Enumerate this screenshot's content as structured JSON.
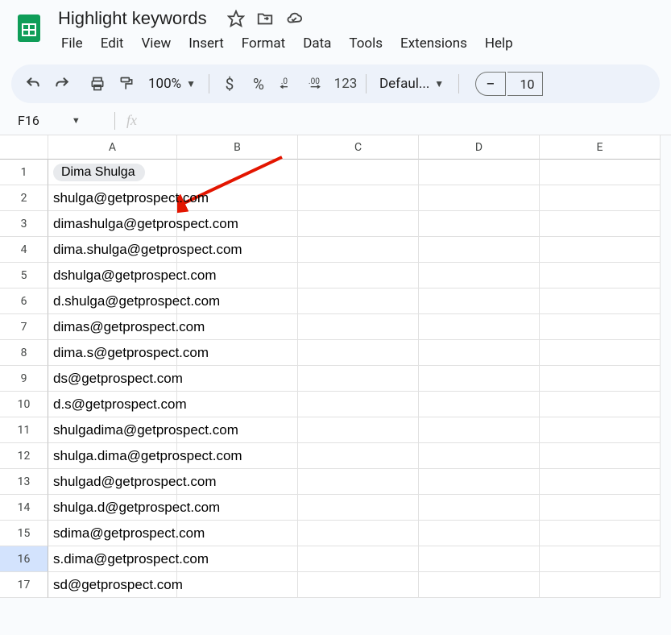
{
  "doc": {
    "title": "Highlight keywords"
  },
  "menubar": [
    "File",
    "Edit",
    "View",
    "Insert",
    "Format",
    "Data",
    "Tools",
    "Extensions",
    "Help"
  ],
  "toolbar": {
    "zoom": "100%",
    "font": "Defaul...",
    "fontsize": "10"
  },
  "namebox": "F16",
  "columns": [
    "A",
    "B",
    "C",
    "D",
    "E"
  ],
  "chart_data": {
    "type": "table",
    "columns": [
      "A"
    ],
    "rows": [
      {
        "n": 1,
        "a": "Dima Shulga",
        "chip": true
      },
      {
        "n": 2,
        "a": "shulga@getprospect.com"
      },
      {
        "n": 3,
        "a": "dimashulga@getprospect.com"
      },
      {
        "n": 4,
        "a": "dima.shulga@getprospect.com"
      },
      {
        "n": 5,
        "a": "dshulga@getprospect.com"
      },
      {
        "n": 6,
        "a": "d.shulga@getprospect.com"
      },
      {
        "n": 7,
        "a": "dimas@getprospect.com"
      },
      {
        "n": 8,
        "a": "dima.s@getprospect.com"
      },
      {
        "n": 9,
        "a": "ds@getprospect.com"
      },
      {
        "n": 10,
        "a": "d.s@getprospect.com"
      },
      {
        "n": 11,
        "a": "shulgadima@getprospect.com"
      },
      {
        "n": 12,
        "a": "shulga.dima@getprospect.com"
      },
      {
        "n": 13,
        "a": "shulgad@getprospect.com"
      },
      {
        "n": 14,
        "a": "shulga.d@getprospect.com"
      },
      {
        "n": 15,
        "a": "sdima@getprospect.com"
      },
      {
        "n": 16,
        "a": "s.dima@getprospect.com",
        "selected": true
      },
      {
        "n": 17,
        "a": "sd@getprospect.com"
      }
    ]
  }
}
